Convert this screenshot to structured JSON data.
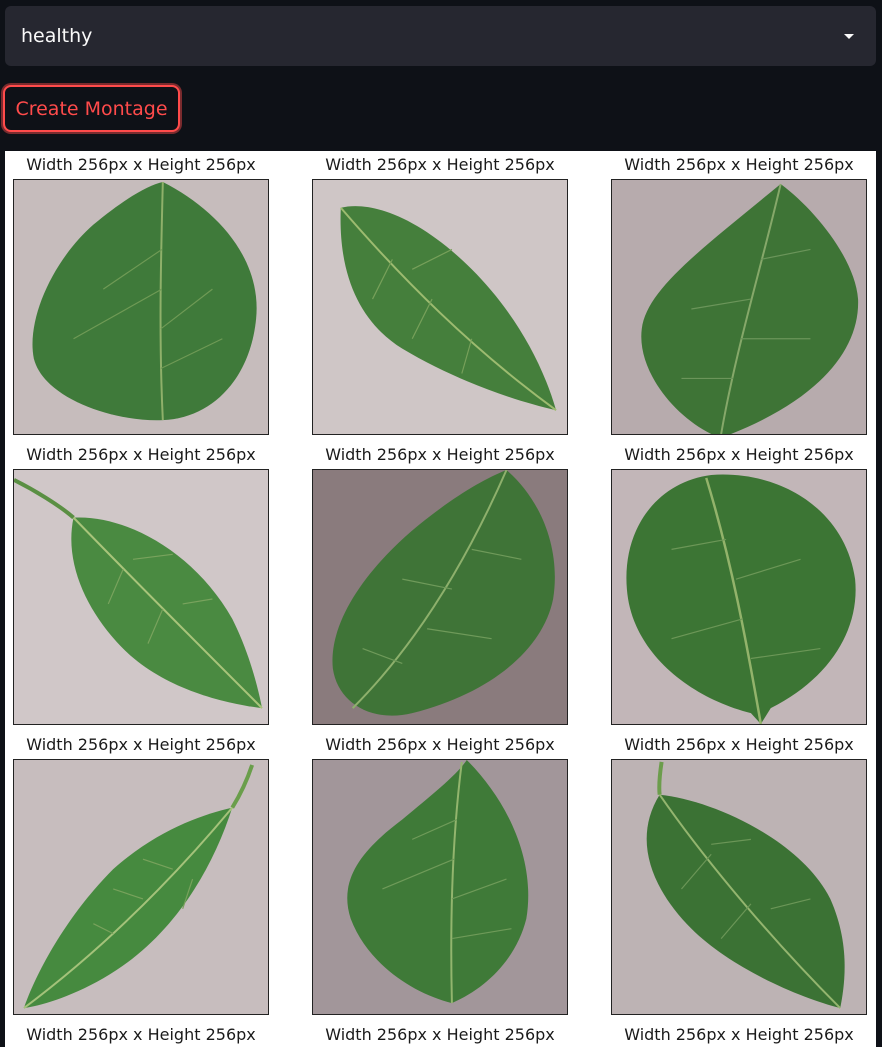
{
  "select": {
    "value": "healthy"
  },
  "button": {
    "label": "Create Montage"
  },
  "montage": {
    "caption": "Width 256px x Height 256px",
    "images": [
      {
        "name": "leaf-image-1",
        "bg": "#c6bcbc",
        "leaf": "#3f7a3a"
      },
      {
        "name": "leaf-image-2",
        "bg": "#cfc6c6",
        "leaf": "#457f3c"
      },
      {
        "name": "leaf-image-3",
        "bg": "#b7abad",
        "leaf": "#3e7436"
      },
      {
        "name": "leaf-image-4",
        "bg": "#d0c7c8",
        "leaf": "#4a8a41"
      },
      {
        "name": "leaf-image-5",
        "bg": "#8a7b7d",
        "leaf": "#3f7437"
      },
      {
        "name": "leaf-image-6",
        "bg": "#c2b6b8",
        "leaf": "#3c7534"
      },
      {
        "name": "leaf-image-7",
        "bg": "#c7bdbe",
        "leaf": "#468a3f"
      },
      {
        "name": "leaf-image-8",
        "bg": "#a2969a",
        "leaf": "#3f7a38"
      },
      {
        "name": "leaf-image-9",
        "bg": "#bdb3b4",
        "leaf": "#3b7234"
      }
    ]
  },
  "colors": {
    "background": "#0e1117",
    "select_bg": "#262730",
    "accent": "#ff4b4b"
  }
}
